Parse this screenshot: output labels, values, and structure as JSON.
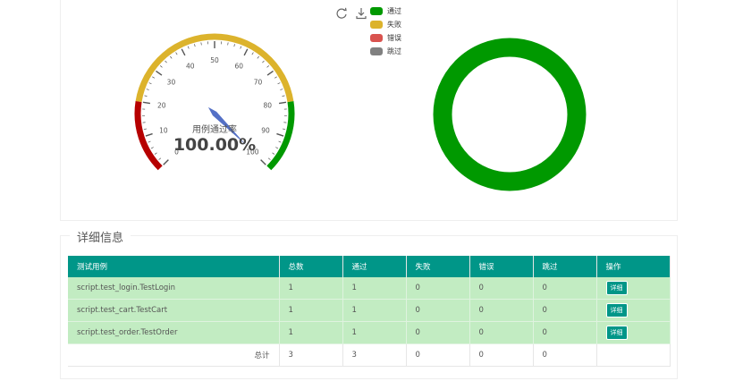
{
  "toolbox": {
    "refresh_icon": "refresh-icon",
    "download_icon": "download-icon"
  },
  "legend": [
    {
      "label": "通过",
      "color": "#009900"
    },
    {
      "label": "失败",
      "color": "#dcb32c"
    },
    {
      "label": "错误",
      "color": "#d9534f"
    },
    {
      "label": "跳过",
      "color": "#808080"
    }
  ],
  "gauge": {
    "title": "用例通过率",
    "value_text": "100.00%",
    "value": 100,
    "min": 0,
    "max": 100,
    "ticks": [
      "0",
      "10",
      "20",
      "30",
      "40",
      "50",
      "60",
      "70",
      "80",
      "90",
      "100"
    ],
    "band_colors": [
      "#b60000",
      "#dcb32c",
      "#009900"
    ],
    "needle_color": "#5470c6"
  },
  "donut": {
    "pass_fraction": 1.0,
    "color": "#009900"
  },
  "details": {
    "title": "详细信息",
    "headers": [
      "测试用例",
      "总数",
      "通过",
      "失败",
      "错误",
      "跳过",
      "操作"
    ],
    "rows": [
      {
        "name": "script.test_login.TestLogin",
        "total": "1",
        "pass": "1",
        "fail": "0",
        "error": "0",
        "skip": "0",
        "action": "详细"
      },
      {
        "name": "script.test_cart.TestCart",
        "total": "1",
        "pass": "1",
        "fail": "0",
        "error": "0",
        "skip": "0",
        "action": "详细"
      },
      {
        "name": "script.test_order.TestOrder",
        "total": "1",
        "pass": "1",
        "fail": "0",
        "error": "0",
        "skip": "0",
        "action": "详细"
      }
    ],
    "summary": {
      "label": "总计",
      "total": "3",
      "pass": "3",
      "fail": "0",
      "error": "0",
      "skip": "0"
    }
  }
}
